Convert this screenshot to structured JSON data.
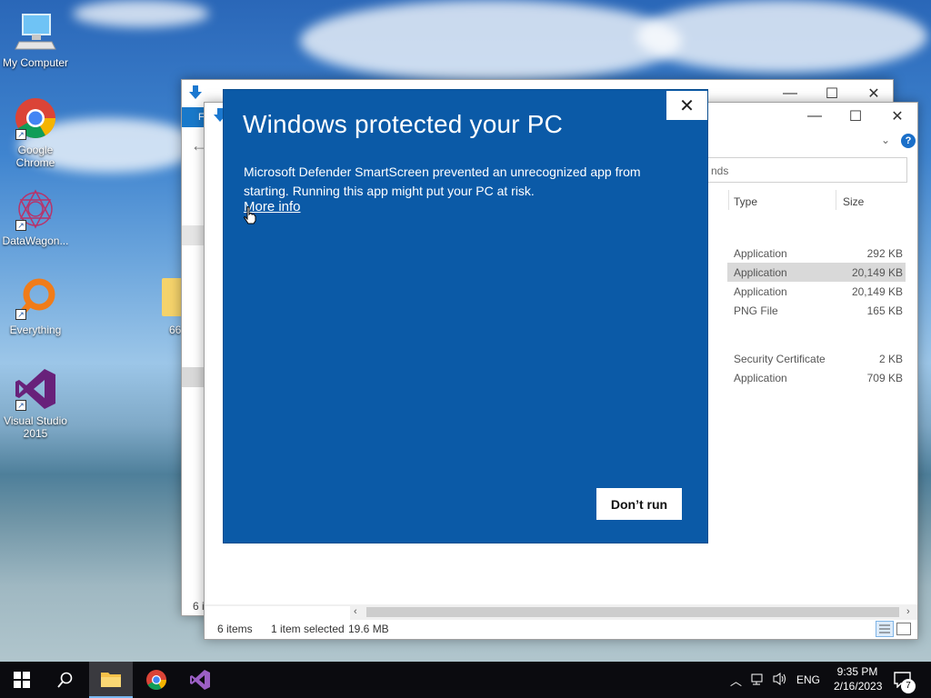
{
  "desktop": {
    "icons": [
      {
        "label": "My Computer",
        "icon": "computer-icon"
      },
      {
        "label": "Google Chrome",
        "icon": "chrome-icon"
      },
      {
        "label": "DataWagon...",
        "icon": "datawagon-icon"
      },
      {
        "label": "Everything",
        "icon": "everything-search-icon"
      },
      {
        "label": "Visual Studio 2015",
        "icon": "visual-studio-icon"
      }
    ],
    "folder_label": "66"
  },
  "explorer_front": {
    "search_placeholder": "nds",
    "columns": {
      "type": "Type",
      "size": "Size"
    },
    "rows": [
      {
        "type": "Application",
        "size": "292 KB",
        "selected": false
      },
      {
        "type": "Application",
        "size": "20,149 KB",
        "selected": true
      },
      {
        "type": "Application",
        "size": "20,149 KB",
        "selected": false
      },
      {
        "type": "PNG File",
        "size": "165 KB",
        "selected": false
      },
      {
        "type": "Security Certificate",
        "size": "2 KB",
        "selected": false
      },
      {
        "type": "Application",
        "size": "709 KB",
        "selected": false
      }
    ],
    "status": {
      "items": "6 items",
      "selected": "1 item selected",
      "size": "19.6 MB"
    },
    "ribbon_tab": "F",
    "back_status": "6 i"
  },
  "smartscreen": {
    "title": "Windows protected your PC",
    "message": "Microsoft Defender SmartScreen prevented an unrecognized app from starting. Running this app might put your PC at risk.",
    "more_info": "More info",
    "dont_run": "Don’t run",
    "close_symbol": "✕"
  },
  "taskbar": {
    "language": "ENG",
    "time": "9:35 PM",
    "date": "2/16/2023",
    "notification_count": "7"
  },
  "colors": {
    "smartscreen_blue": "#0b5aa7",
    "explorer_accent": "#1979ca",
    "taskbar": "#0b0b0f"
  }
}
